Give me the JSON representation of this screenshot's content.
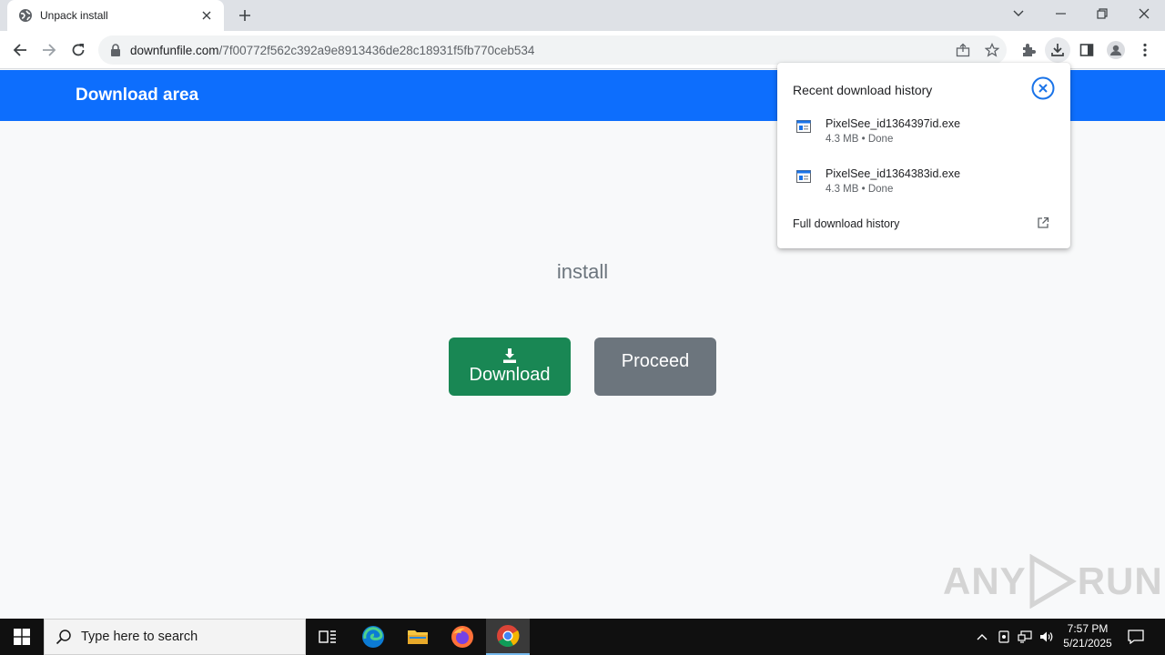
{
  "browser": {
    "tab_title": "Unpack install",
    "url_domain": "downfunfile.com",
    "url_path": "/7f00772f562c392a9e8913436de28c18931f5fb770ceb534"
  },
  "page": {
    "banner_title": "Download area",
    "heading": "install",
    "download_button": "Download",
    "proceed_button": "Proceed"
  },
  "download_bubble": {
    "title": "Recent download history",
    "items": [
      {
        "name": "PixelSee_id1364397id.exe",
        "meta": "4.3 MB • Done"
      },
      {
        "name": "PixelSee_id1364383id.exe",
        "meta": "4.3 MB • Done"
      }
    ],
    "footer": "Full download history"
  },
  "taskbar": {
    "search_placeholder": "Type here to search",
    "time": "7:57 PM",
    "date": "5/21/2025"
  },
  "watermark": {
    "text_left": "ANY",
    "text_right": "RUN"
  },
  "colors": {
    "banner": "#0d6efd",
    "download": "#198754",
    "proceed": "#6c757d",
    "bubble_close": "#1a73e8"
  }
}
